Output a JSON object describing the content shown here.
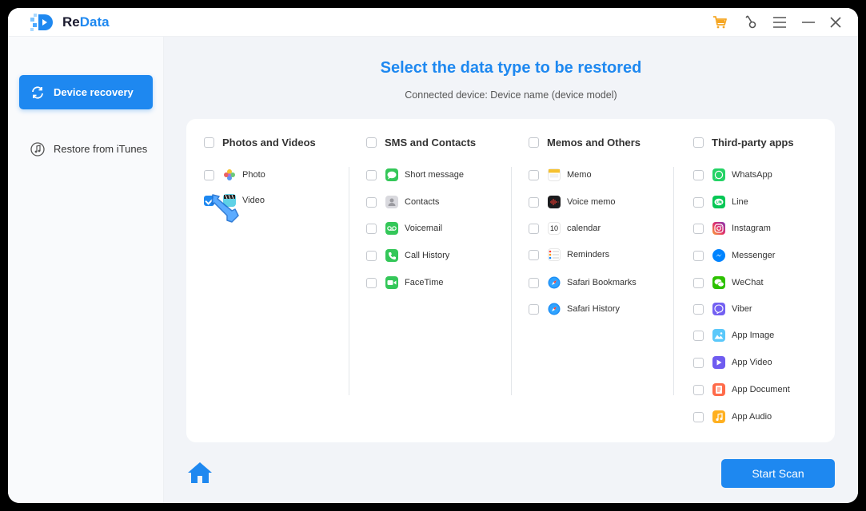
{
  "app": {
    "name_part1": "Re",
    "name_part2": "Data"
  },
  "sidebar": {
    "items": [
      {
        "label": "Device recovery",
        "active": true
      },
      {
        "label": "Restore from iTunes",
        "active": false
      }
    ]
  },
  "main": {
    "title": "Select the data type to be restored",
    "subtitle": "Connected device: Device name (device model)",
    "start_scan_label": "Start Scan"
  },
  "categories": [
    {
      "label": "Photos and Videos",
      "items": [
        {
          "label": "Photo",
          "icon": "photos-icon",
          "checked": false
        },
        {
          "label": "Video",
          "icon": "video-clapper-icon",
          "checked": true
        }
      ]
    },
    {
      "label": "SMS and Contacts",
      "items": [
        {
          "label": "Short message",
          "icon": "messages-icon",
          "checked": false
        },
        {
          "label": "Contacts",
          "icon": "contacts-icon",
          "checked": false
        },
        {
          "label": "Voicemail",
          "icon": "voicemail-icon",
          "checked": false
        },
        {
          "label": "Call History",
          "icon": "phone-icon",
          "checked": false
        },
        {
          "label": "FaceTime",
          "icon": "facetime-icon",
          "checked": false
        }
      ]
    },
    {
      "label": "Memos and Others",
      "items": [
        {
          "label": "Memo",
          "icon": "notes-icon",
          "checked": false
        },
        {
          "label": "Voice memo",
          "icon": "voice-memo-icon",
          "checked": false
        },
        {
          "label": "calendar",
          "icon": "calendar-icon",
          "checked": false
        },
        {
          "label": "Reminders",
          "icon": "reminders-icon",
          "checked": false
        },
        {
          "label": "Safari Bookmarks",
          "icon": "safari-icon",
          "checked": false
        },
        {
          "label": "Safari History",
          "icon": "safari-icon",
          "checked": false
        }
      ]
    },
    {
      "label": "Third-party apps",
      "items": [
        {
          "label": "WhatsApp",
          "icon": "whatsapp-icon",
          "checked": false
        },
        {
          "label": "Line",
          "icon": "line-icon",
          "checked": false
        },
        {
          "label": "Instagram",
          "icon": "instagram-icon",
          "checked": false
        },
        {
          "label": "Messenger",
          "icon": "messenger-icon",
          "checked": false
        },
        {
          "label": "WeChat",
          "icon": "wechat-icon",
          "checked": false
        },
        {
          "label": "Viber",
          "icon": "viber-icon",
          "checked": false
        },
        {
          "label": "App Image",
          "icon": "app-image-icon",
          "checked": false
        },
        {
          "label": "App Video",
          "icon": "app-video-icon",
          "checked": false
        },
        {
          "label": "App Document",
          "icon": "app-document-icon",
          "checked": false
        },
        {
          "label": "App Audio",
          "icon": "app-audio-icon",
          "checked": false
        }
      ]
    }
  ],
  "calendar_day": "10",
  "colors": {
    "accent": "#1e88f0",
    "background": "#f2f4f8",
    "cart": "#f5a623"
  }
}
